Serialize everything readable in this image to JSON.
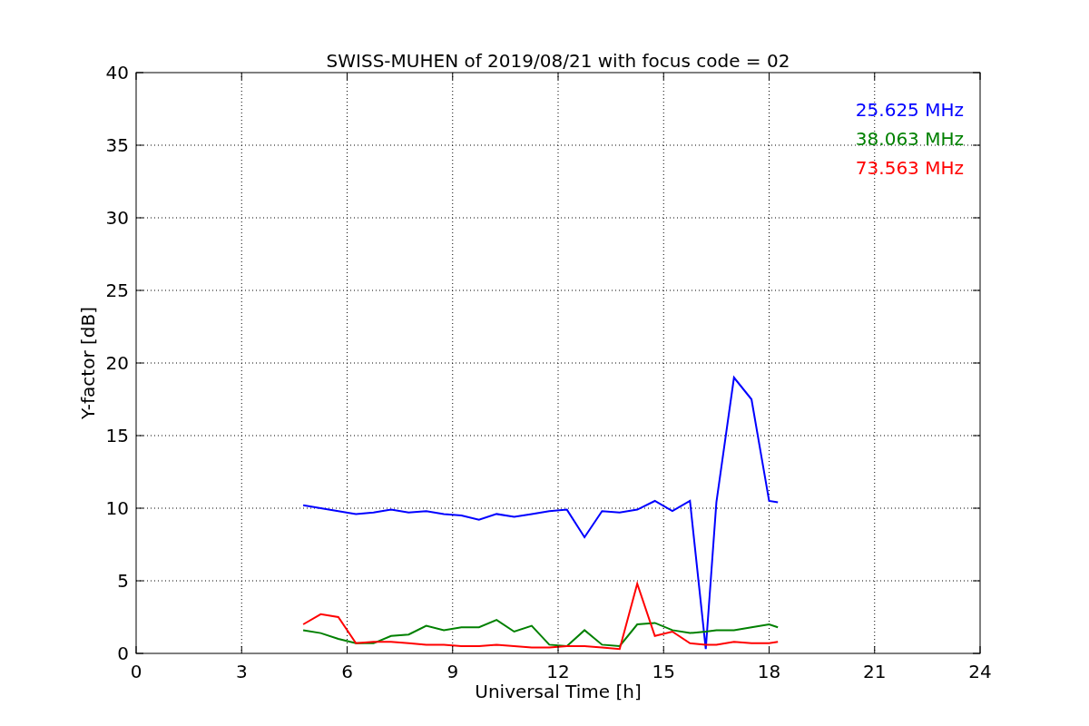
{
  "chart_data": {
    "type": "line",
    "title": "SWISS-MUHEN of 2019/08/21 with focus code = 02",
    "xlabel": "Universal Time [h]",
    "ylabel": "Y-factor [dB]",
    "x": [
      4.75,
      5.25,
      5.75,
      6.25,
      6.75,
      7.25,
      7.75,
      8.25,
      8.75,
      9.25,
      9.75,
      10.25,
      10.75,
      11.25,
      11.75,
      12.25,
      12.75,
      13.25,
      13.75,
      14.25,
      14.75,
      15.25,
      15.75,
      16.2,
      16.5,
      17.0,
      17.5,
      18.0,
      18.25
    ],
    "series": [
      {
        "name": "25.625 MHz",
        "color": "#0000ff",
        "values": [
          10.2,
          10,
          9.8,
          9.6,
          9.7,
          9.9,
          9.7,
          9.8,
          9.6,
          9.5,
          9.2,
          9.6,
          9.4,
          9.6,
          9.8,
          9.9,
          8.0,
          9.8,
          9.7,
          9.9,
          10.5,
          9.8,
          10.5,
          0.3,
          10.4,
          19,
          17.5,
          10.5,
          10.4
        ]
      },
      {
        "name": "38.063 MHz",
        "color": "#008000",
        "values": [
          1.6,
          1.4,
          1.0,
          0.7,
          0.7,
          1.2,
          1.3,
          1.9,
          1.6,
          1.8,
          1.8,
          2.3,
          1.5,
          1.9,
          0.6,
          0.5,
          1.6,
          0.6,
          0.5,
          2.0,
          2.1,
          1.6,
          1.4,
          1.5,
          1.6,
          1.6,
          1.8,
          2.0,
          1.8
        ]
      },
      {
        "name": "73.563 MHz",
        "color": "#ff0000",
        "values": [
          2.0,
          2.7,
          2.5,
          0.7,
          0.8,
          0.8,
          0.7,
          0.6,
          0.6,
          0.5,
          0.5,
          0.6,
          0.5,
          0.4,
          0.4,
          0.5,
          0.5,
          0.4,
          0.3,
          4.8,
          1.2,
          1.5,
          0.7,
          0.6,
          0.6,
          0.8,
          0.7,
          0.7,
          0.8
        ]
      }
    ],
    "grid": true,
    "xlim": [
      0,
      24
    ],
    "ylim": [
      0,
      40
    ],
    "xticks": [
      0,
      3,
      6,
      9,
      12,
      15,
      18,
      21,
      24
    ],
    "yticks": [
      0,
      5,
      10,
      15,
      20,
      25,
      30,
      35,
      40
    ]
  }
}
